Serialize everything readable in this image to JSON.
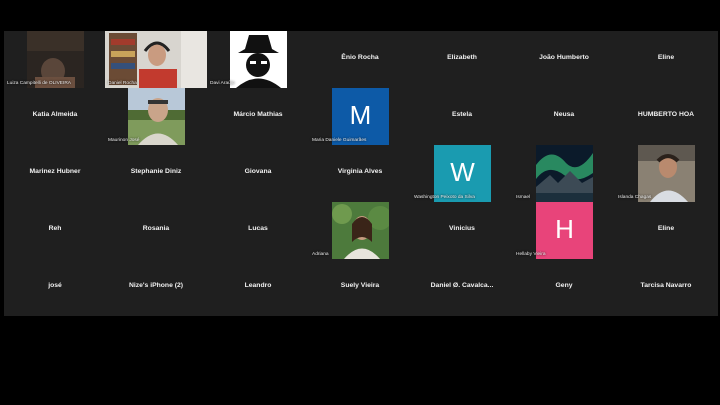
{
  "meeting": {
    "rows": [
      [
        {
          "name": "Luiza Campitelli de OLIVEIRA",
          "type": "video",
          "theme": "dark-room"
        },
        {
          "name": "Daniel Rocha",
          "type": "video",
          "theme": "studio"
        },
        {
          "name": "Davi Araújo",
          "type": "video",
          "theme": "bw-hat"
        },
        {
          "name": "Ênio Rocha",
          "type": "name"
        },
        {
          "name": "Elizabeth",
          "type": "name"
        },
        {
          "name": "João Humberto",
          "type": "name"
        },
        {
          "name": "Eline",
          "type": "name"
        }
      ],
      [
        {
          "name": "Katia Almeida",
          "type": "name"
        },
        {
          "name": "Maurinon José",
          "type": "video",
          "theme": "field"
        },
        {
          "name": "Márcio Mathias",
          "type": "name"
        },
        {
          "name": "Maria Daniele Guimarães",
          "type": "avatar",
          "letter": "M",
          "color": "#0d5aa7"
        },
        {
          "name": "Estela",
          "type": "name"
        },
        {
          "name": "Neusa",
          "type": "name"
        },
        {
          "name": "HUMBERTO HOA",
          "type": "name"
        }
      ],
      [
        {
          "name": "Marinez  Hubner",
          "type": "name"
        },
        {
          "name": "Stephanie Diniz",
          "type": "name"
        },
        {
          "name": "Giovana",
          "type": "name"
        },
        {
          "name": "Virginia Alves",
          "type": "name"
        },
        {
          "name": "Washington Peixoto da Silva",
          "type": "avatar",
          "letter": "W",
          "color": "#1a9bb0"
        },
        {
          "name": "Ismael",
          "type": "video",
          "theme": "aurora"
        },
        {
          "name": "Islanda Chagas",
          "type": "video",
          "theme": "cafe"
        }
      ],
      [
        {
          "name": "Reh",
          "type": "name"
        },
        {
          "name": "Rosania",
          "type": "name"
        },
        {
          "name": "Lucas",
          "type": "name"
        },
        {
          "name": "Adriana",
          "type": "video",
          "theme": "greenery"
        },
        {
          "name": "Vinicius",
          "type": "name"
        },
        {
          "name": "Hellaby Vieira",
          "type": "avatar",
          "letter": "H",
          "color": "#e8447a"
        },
        {
          "name": "Eline",
          "type": "name"
        }
      ],
      [
        {
          "name": "josé",
          "type": "name"
        },
        {
          "name": "Nize's iPhone (2)",
          "type": "name"
        },
        {
          "name": "Leandro",
          "type": "name"
        },
        {
          "name": "Suely Vieira",
          "type": "name"
        },
        {
          "name": "Daniel Ø. Cavalca...",
          "type": "name"
        },
        {
          "name": "Geny",
          "type": "name"
        },
        {
          "name": "Tarcisa Navarro",
          "type": "name"
        }
      ]
    ]
  }
}
